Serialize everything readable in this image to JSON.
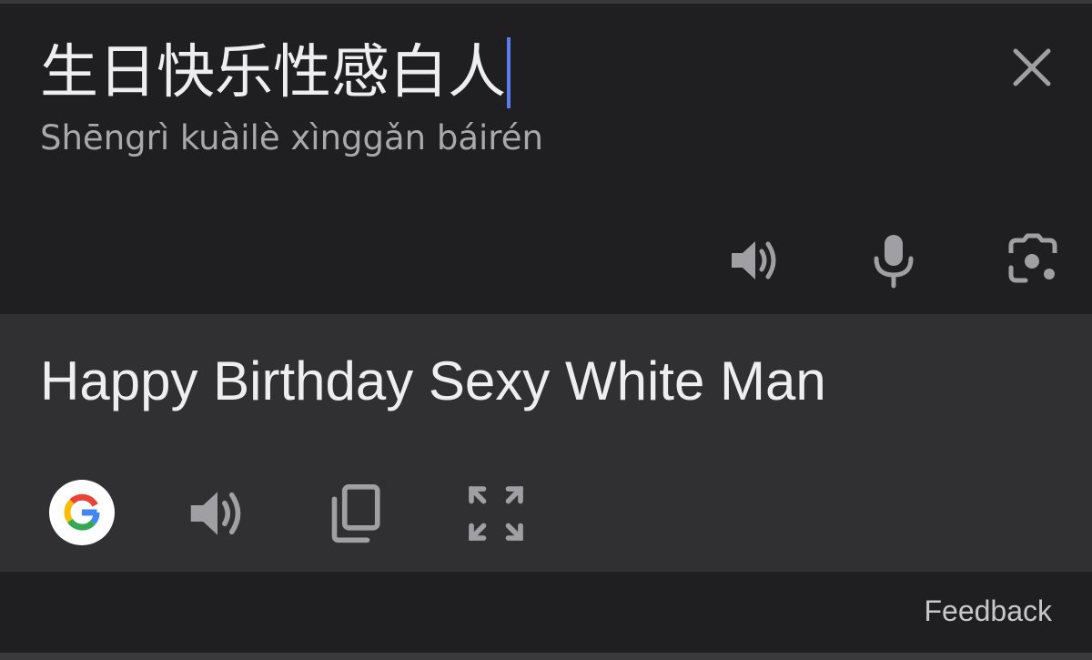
{
  "source": {
    "text": "生日快乐性感白人",
    "romanization": "Shēngrì kuàilè xìnggǎn báirén",
    "actions": {
      "clear_icon": "close-icon",
      "listen_icon": "speaker-icon",
      "voice_icon": "microphone-icon",
      "camera_icon": "camera-lens-icon"
    }
  },
  "translation": {
    "text": "Happy Birthday Sexy White Man",
    "actions": {
      "google_icon": "google-logo-icon",
      "listen_icon": "speaker-icon",
      "copy_icon": "copy-icon",
      "fullscreen_icon": "fullscreen-icon"
    }
  },
  "footer": {
    "feedback_label": "Feedback"
  },
  "colors": {
    "background": "#1f1f21",
    "translation_panel": "#303033",
    "text": "#eeeef0",
    "secondary_text": "#a9a9ad",
    "icon": "#a0a0a4",
    "caret": "#5b7cf5"
  }
}
